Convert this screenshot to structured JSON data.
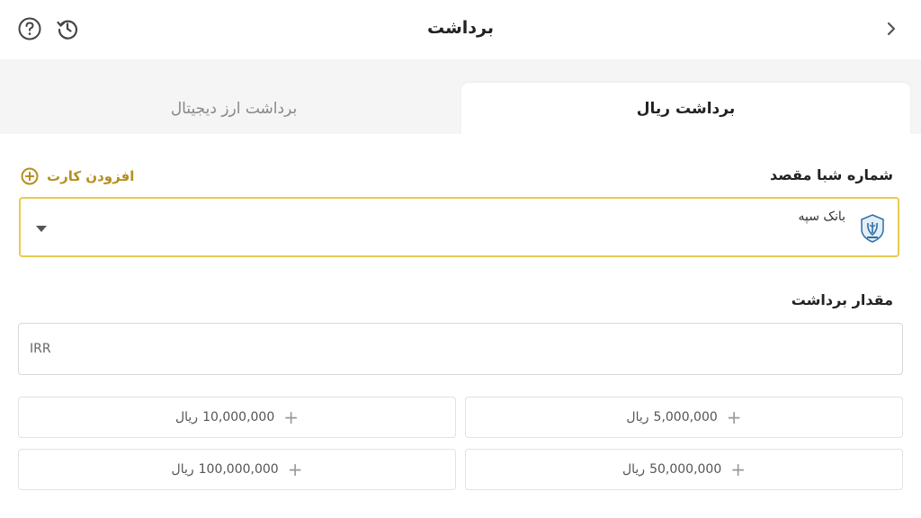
{
  "header": {
    "title": "برداشت",
    "help_icon": "question-circle-icon",
    "history_icon": "history-icon",
    "back_icon": "chevron-right-icon"
  },
  "tabs": [
    {
      "label": "برداشت ریال",
      "active": true
    },
    {
      "label": "برداشت ارز دیجیتال",
      "active": false
    }
  ],
  "destination": {
    "label": "شماره شبا مقصد",
    "add_card_label": "افزودن کارت",
    "add_card_icon": "plus-circle-icon",
    "selected_bank": "بانک سپه",
    "bank_logo_icon": "bank-sepah-logo-icon",
    "dropdown_icon": "caret-down-icon"
  },
  "amount": {
    "label": "مقدار برداشت",
    "placeholder": "IRR",
    "value": ""
  },
  "presets": [
    {
      "value": "5,000,000",
      "unit": "ریال"
    },
    {
      "value": "10,000,000",
      "unit": "ریال"
    },
    {
      "value": "50,000,000",
      "unit": "ریال"
    },
    {
      "value": "100,000,000",
      "unit": "ریال"
    }
  ],
  "colors": {
    "accent": "#e8cb52",
    "accent_text": "#b58f1f",
    "tab_bg": "#f5f5f5"
  }
}
